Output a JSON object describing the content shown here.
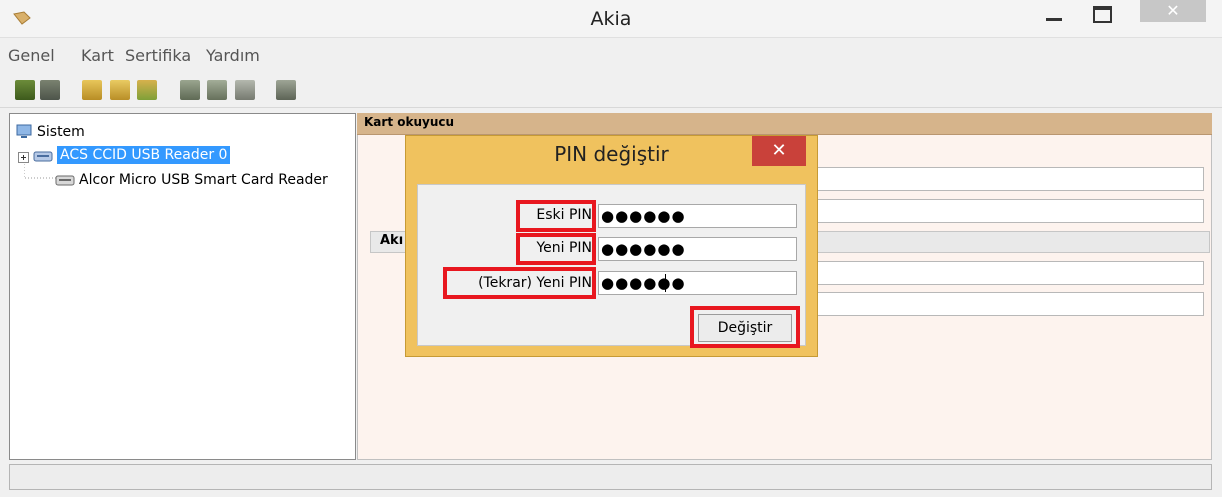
{
  "window": {
    "title": "Akia",
    "close_glyph": "✕"
  },
  "menu": [
    "Genel",
    "Kart",
    "Sertifika",
    "Yardım"
  ],
  "toolbar_icons": [
    "login-icon",
    "logout-icon",
    "lock-icon",
    "unlock-icon",
    "lock-arrow-icon",
    "certificate-icon",
    "signature-icon",
    "document-icon",
    "grid-icon"
  ],
  "tree": {
    "root": "Sistem",
    "items": [
      "ACS CCID USB Reader 0",
      "Alcor Micro USB Smart Card Reader"
    ]
  },
  "right_panel": {
    "header": "Kart okuyucu",
    "section_label": "Akı"
  },
  "dialog": {
    "title": "PIN değiştir",
    "close_glyph": "✕",
    "labels": [
      "Eski PIN",
      "Yeni PIN",
      "(Tekrar) Yeni PIN"
    ],
    "values": [
      "●●●●●●",
      "●●●●●●",
      "●●●●●●"
    ],
    "button": "Değiştir"
  },
  "colors": {
    "highlight": "#e8171f",
    "dialog": "#f0c25e",
    "selected": "#3399ff",
    "panel_header": "#d6b48b"
  }
}
